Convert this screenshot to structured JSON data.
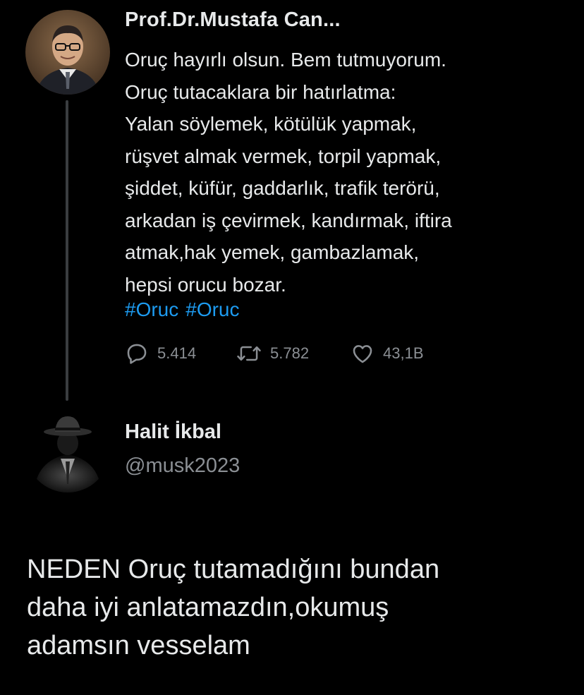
{
  "tweet": {
    "author_name": "Prof.Dr.Mustafa Can...",
    "text_lines": [
      "Oruç hayırlı olsun. Bem tutmuyorum.",
      "Oruç tutacaklara bir hatırlatma:",
      "Yalan söylemek, kötülük yapmak,",
      "rüşvet almak vermek, torpil yapmak,",
      "şiddet, küfür, gaddarlık, trafik terörü,",
      "arkadan iş çevirmek, kandırmak, iftira",
      "atmak,hak yemek, gambazlamak,",
      "hepsi orucu bozar."
    ],
    "hashtags": [
      "#Oruc",
      "#Oruc"
    ],
    "stats": {
      "replies": "5.414",
      "retweets": "5.782",
      "likes": "43,1B"
    },
    "icons": {
      "reply": "reply-icon",
      "retweet": "retweet-icon",
      "like": "heart-icon"
    }
  },
  "reply": {
    "author_name": "Halit İkbal",
    "handle": "@musk2023"
  },
  "comment": {
    "lines": [
      "NEDEN Oruç tutamadığını bundan",
      "daha iyi anlatamazdın,okumuş",
      "adamsın vesselam"
    ]
  },
  "colors": {
    "background": "#000000",
    "text": "#e7e9ea",
    "muted": "#8b8f94",
    "hashtag": "#1d9bf0"
  }
}
